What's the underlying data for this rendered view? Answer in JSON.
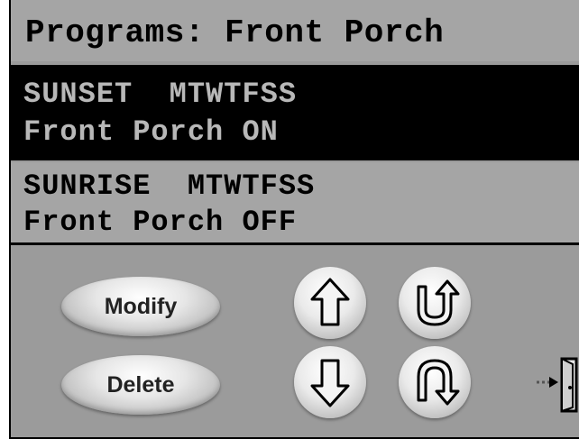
{
  "header": {
    "title": "Programs: Front Porch"
  },
  "programs": [
    {
      "line1": "SUNSET  MTWTFSS",
      "line2": "Front Porch ON",
      "selected": true
    },
    {
      "line1": "SUNRISE  MTWTFSS",
      "line2": "Front Porch OFF",
      "selected": false
    }
  ],
  "buttons": {
    "modify": "Modify",
    "delete": "Delete"
  },
  "icons": {
    "up": "arrow-up-icon",
    "down": "arrow-down-icon",
    "rotate_ccw": "rotate-counterclockwise-icon",
    "rotate_cw": "rotate-clockwise-icon",
    "exit": "exit-door-icon"
  },
  "colors": {
    "panel": "#9b9b9b",
    "selected_row": "#000000",
    "selected_text": "#b8b8b8"
  }
}
